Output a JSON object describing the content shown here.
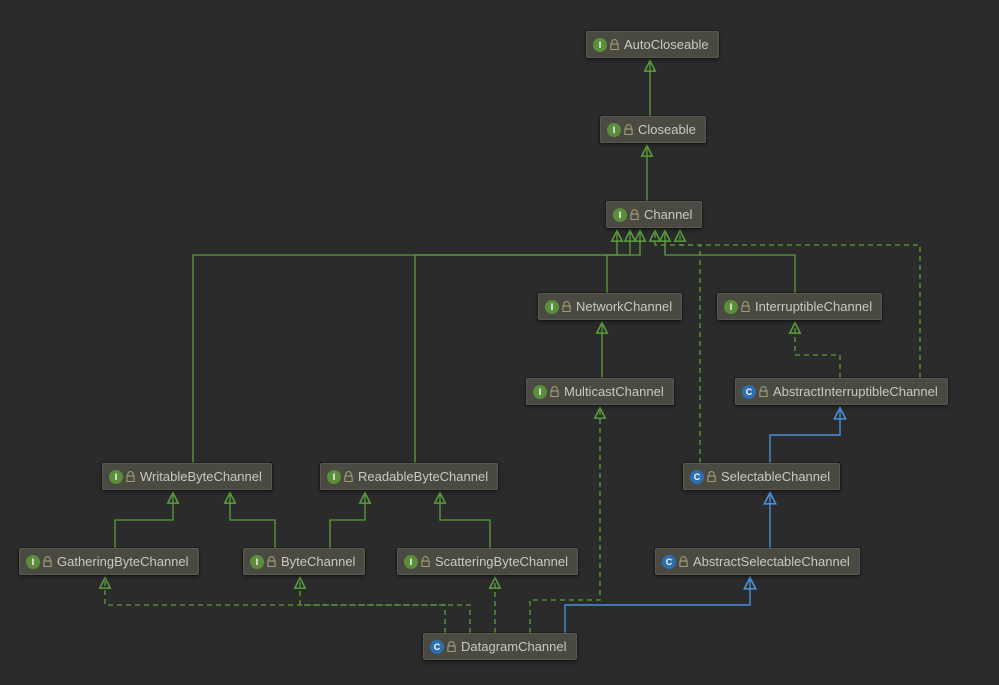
{
  "nodes": {
    "autocloseable": {
      "label": "AutoCloseable",
      "kind": "interface"
    },
    "closeable": {
      "label": "Closeable",
      "kind": "interface"
    },
    "channel": {
      "label": "Channel",
      "kind": "interface"
    },
    "networkchannel": {
      "label": "NetworkChannel",
      "kind": "interface"
    },
    "interruptible": {
      "label": "InterruptibleChannel",
      "kind": "interface"
    },
    "multicast": {
      "label": "MulticastChannel",
      "kind": "interface"
    },
    "abs_interrupt": {
      "label": "AbstractInterruptibleChannel",
      "kind": "class"
    },
    "writable": {
      "label": "WritableByteChannel",
      "kind": "interface"
    },
    "readable": {
      "label": "ReadableByteChannel",
      "kind": "interface"
    },
    "selectable": {
      "label": "SelectableChannel",
      "kind": "class"
    },
    "gathering": {
      "label": "GatheringByteChannel",
      "kind": "interface"
    },
    "bytechannel": {
      "label": "ByteChannel",
      "kind": "interface"
    },
    "scattering": {
      "label": "ScatteringByteChannel",
      "kind": "interface"
    },
    "abs_selectable": {
      "label": "AbstractSelectableChannel",
      "kind": "class"
    },
    "datagram": {
      "label": "DatagramChannel",
      "kind": "class"
    }
  },
  "colors": {
    "bg": "#2b2b2b",
    "node_bg": "#4a4a42",
    "text": "#c9c9c1",
    "green": "#5b9e3d",
    "blue": "#4a8fd8"
  },
  "edges": [
    {
      "from": "closeable",
      "to": "autocloseable",
      "style": "solid-green"
    },
    {
      "from": "channel",
      "to": "closeable",
      "style": "solid-green"
    },
    {
      "from": "networkchannel",
      "to": "channel",
      "style": "solid-green"
    },
    {
      "from": "interruptible",
      "to": "channel",
      "style": "solid-green"
    },
    {
      "from": "multicast",
      "to": "networkchannel",
      "style": "solid-green"
    },
    {
      "from": "abs_interrupt",
      "to": "interruptible",
      "style": "dashed-green"
    },
    {
      "from": "abs_interrupt",
      "to": "channel",
      "style": "dashed-green"
    },
    {
      "from": "writable",
      "to": "channel",
      "style": "solid-green"
    },
    {
      "from": "readable",
      "to": "channel",
      "style": "solid-green"
    },
    {
      "from": "selectable",
      "to": "abs_interrupt",
      "style": "solid-blue"
    },
    {
      "from": "selectable",
      "to": "channel",
      "style": "dashed-green"
    },
    {
      "from": "gathering",
      "to": "writable",
      "style": "solid-green"
    },
    {
      "from": "bytechannel",
      "to": "writable",
      "style": "solid-green"
    },
    {
      "from": "bytechannel",
      "to": "readable",
      "style": "solid-green"
    },
    {
      "from": "scattering",
      "to": "readable",
      "style": "solid-green"
    },
    {
      "from": "abs_selectable",
      "to": "selectable",
      "style": "solid-blue"
    },
    {
      "from": "datagram",
      "to": "abs_selectable",
      "style": "solid-blue"
    },
    {
      "from": "datagram",
      "to": "gathering",
      "style": "dashed-green"
    },
    {
      "from": "datagram",
      "to": "bytechannel",
      "style": "dashed-green"
    },
    {
      "from": "datagram",
      "to": "scattering",
      "style": "dashed-green"
    },
    {
      "from": "datagram",
      "to": "multicast",
      "style": "dashed-green"
    }
  ]
}
